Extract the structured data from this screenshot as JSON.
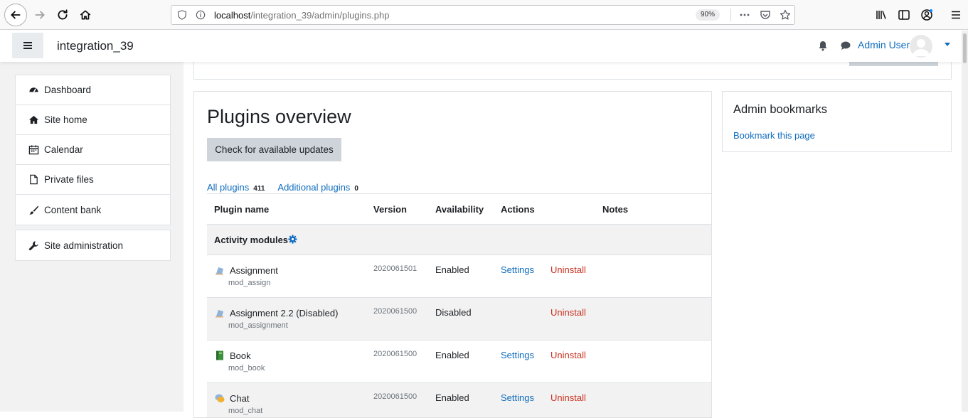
{
  "browser": {
    "url_host": "localhost",
    "url_path": "/integration_39/admin/plugins.php",
    "zoom": "90%"
  },
  "header": {
    "site_name": "integration_39",
    "user_name": "Admin User"
  },
  "nav": {
    "items": [
      {
        "label": "Dashboard",
        "icon": "dashboard-icon"
      },
      {
        "label": "Site home",
        "icon": "home-icon"
      },
      {
        "label": "Calendar",
        "icon": "calendar-icon"
      },
      {
        "label": "Private files",
        "icon": "file-icon"
      },
      {
        "label": "Content bank",
        "icon": "paintbrush-icon"
      }
    ],
    "admin": {
      "label": "Site administration",
      "icon": "wrench-icon"
    }
  },
  "main": {
    "title": "Plugins overview",
    "check_button": "Check for available updates",
    "filters": [
      {
        "label": "All plugins",
        "count": "411"
      },
      {
        "label": "Additional plugins",
        "count": "0"
      }
    ],
    "columns": [
      "Plugin name",
      "Version",
      "Availability",
      "Actions",
      "Notes"
    ],
    "category": "Activity modules",
    "plugins": [
      {
        "name": "Assignment",
        "component": "mod_assign",
        "version": "2020061501",
        "availability": "Enabled",
        "settings": "Settings",
        "uninstall": "Uninstall",
        "icon": "assignment-icon"
      },
      {
        "name": "Assignment 2.2 (Disabled)",
        "component": "mod_assignment",
        "version": "2020061500",
        "availability": "Disabled",
        "settings": "",
        "uninstall": "Uninstall",
        "icon": "assignment-icon"
      },
      {
        "name": "Book",
        "component": "mod_book",
        "version": "2020061500",
        "availability": "Enabled",
        "settings": "Settings",
        "uninstall": "Uninstall",
        "icon": "book-icon"
      },
      {
        "name": "Chat",
        "component": "mod_chat",
        "version": "2020061500",
        "availability": "Enabled",
        "settings": "Settings",
        "uninstall": "Uninstall",
        "icon": "chat-icon"
      }
    ]
  },
  "block": {
    "title": "Admin bookmarks",
    "link": "Bookmark this page"
  },
  "colors": {
    "link": "#0f6cbf",
    "danger": "#ca3120",
    "button_bg": "#ced4da",
    "stripe": "#f2f2f2"
  }
}
